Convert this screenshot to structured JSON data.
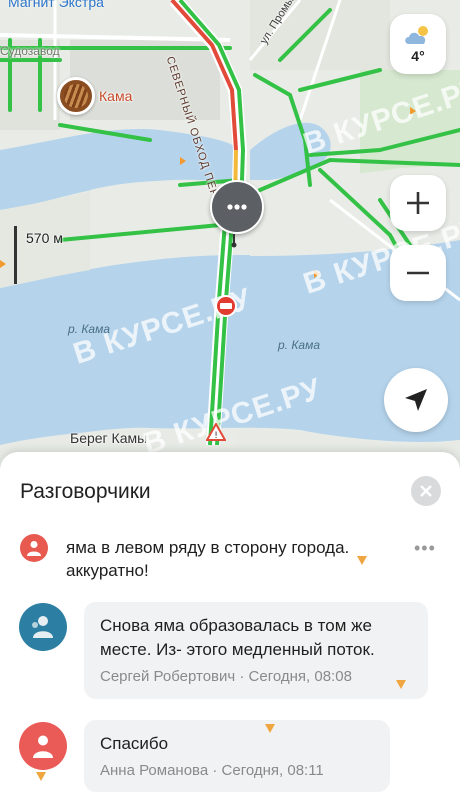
{
  "map": {
    "store_label": "Магнит Экстра",
    "poi_label": "Кама",
    "road_label": "СЕВЕРНЫЙ ОБХОД ПЕРМИ",
    "street_label": "ул. Промышленная",
    "area_label": "Судозавод",
    "bank_label": "Берег Камы",
    "river_label_left": "р. Кама",
    "river_label_right": "р. Кама",
    "scale_label": "570 м",
    "weather_temp": "4°",
    "watermark": "В КУРСЕ.РУ",
    "colors": {
      "water": "#b5d4ec",
      "traffic_green": "#33c146",
      "traffic_red": "#e24a3a",
      "traffic_yellow": "#f2b93b"
    }
  },
  "controls": {
    "weather_icon": "cloud-sun-icon",
    "zoom_in_icon": "plus-icon",
    "zoom_out_icon": "minus-icon",
    "locate_icon": "navigation-arrow-icon"
  },
  "sheet": {
    "title": "Разговорчики",
    "close_icon": "close-icon",
    "main_message": {
      "text": "яма в левом ряду в сторону города. аккуратно!",
      "more_icon": "more-dots-icon"
    },
    "replies": [
      {
        "text": "Снова яма образовалась в том же месте. Из- этого медленный поток.",
        "author": "Сергей Робертович",
        "time": "Сегодня, 08:08",
        "meta": "Сергей Робертович · Сегодня, 08:08",
        "avatar_color": "#2c7fa3"
      },
      {
        "text": "Спасибо",
        "author": "Анна Романова",
        "time": "Сегодня, 08:11",
        "meta": "Анна Романова · Сегодня, 08:11",
        "avatar_color": "#ea5b57"
      }
    ]
  }
}
